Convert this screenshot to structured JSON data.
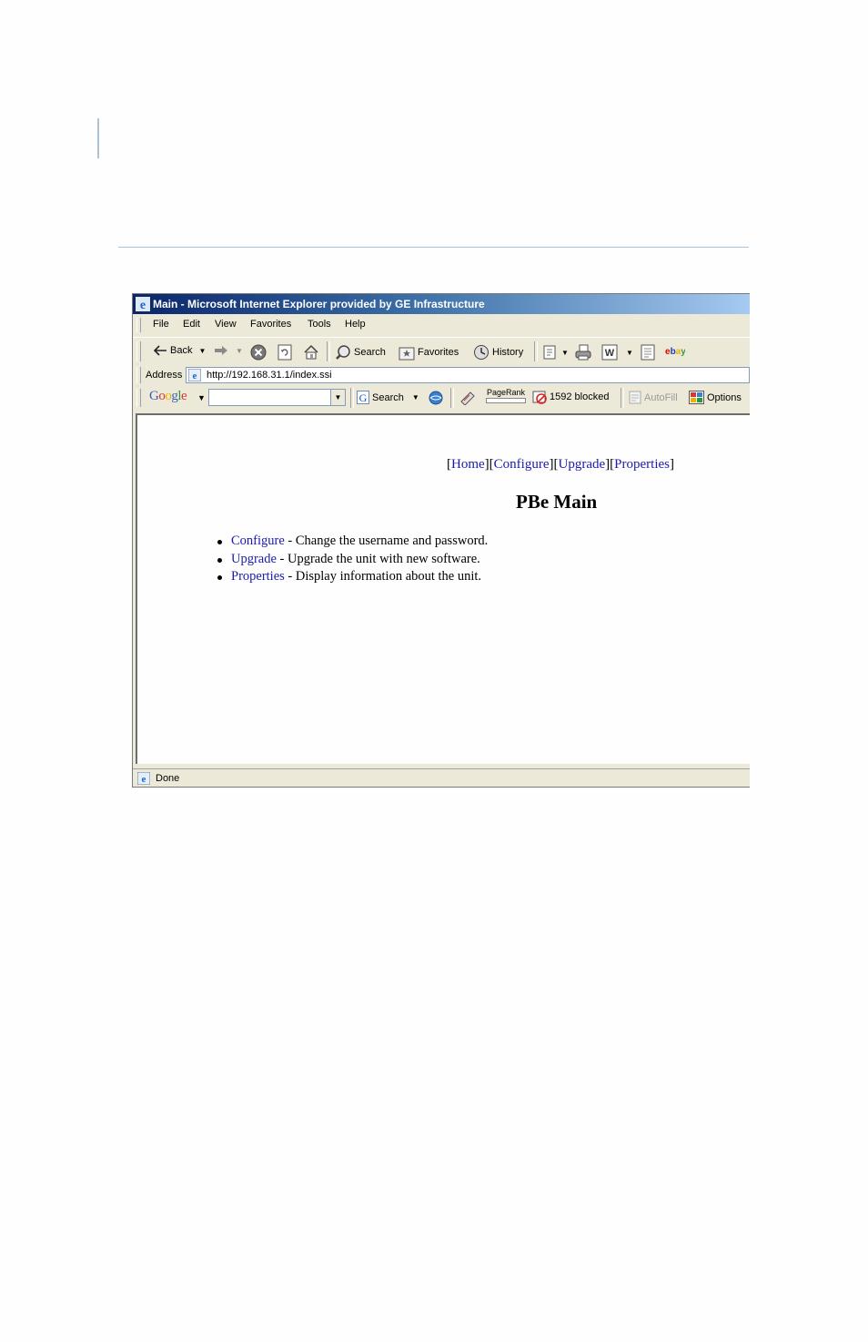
{
  "window": {
    "title": "Main - Microsoft Internet Explorer provided by GE Infrastructure"
  },
  "menu": [
    "File",
    "Edit",
    "View",
    "Favorites",
    "Tools",
    "Help"
  ],
  "toolbar": {
    "back_label": "Back",
    "search_label": "Search",
    "favorites_label": "Favorites",
    "history_label": "History"
  },
  "address": {
    "label": "Address",
    "url": "http://192.168.31.1/index.ssi"
  },
  "google_toolbar": {
    "logo_text": "Google",
    "search_value": "",
    "search_label": "Search",
    "pagerank_label": "PageRank",
    "blocked_label": "1592 blocked",
    "autofill_label": "AutoFill",
    "options_label": "Options"
  },
  "page": {
    "nav": {
      "home": "Home",
      "configure": "Configure",
      "upgrade": "Upgrade",
      "properties": "Properties"
    },
    "heading": "PBe Main",
    "items": [
      {
        "link": "Configure",
        "desc": " - Change the username and password."
      },
      {
        "link": "Upgrade",
        "desc": " - Upgrade the unit with new software."
      },
      {
        "link": "Properties",
        "desc": " - Display information about the unit."
      }
    ]
  },
  "status": {
    "text": "Done"
  },
  "colors": {
    "link": "#1a1ab0",
    "titlebar_start": "#0a246a",
    "chrome": "#ece9d8",
    "rule": "#a9c4d9"
  }
}
